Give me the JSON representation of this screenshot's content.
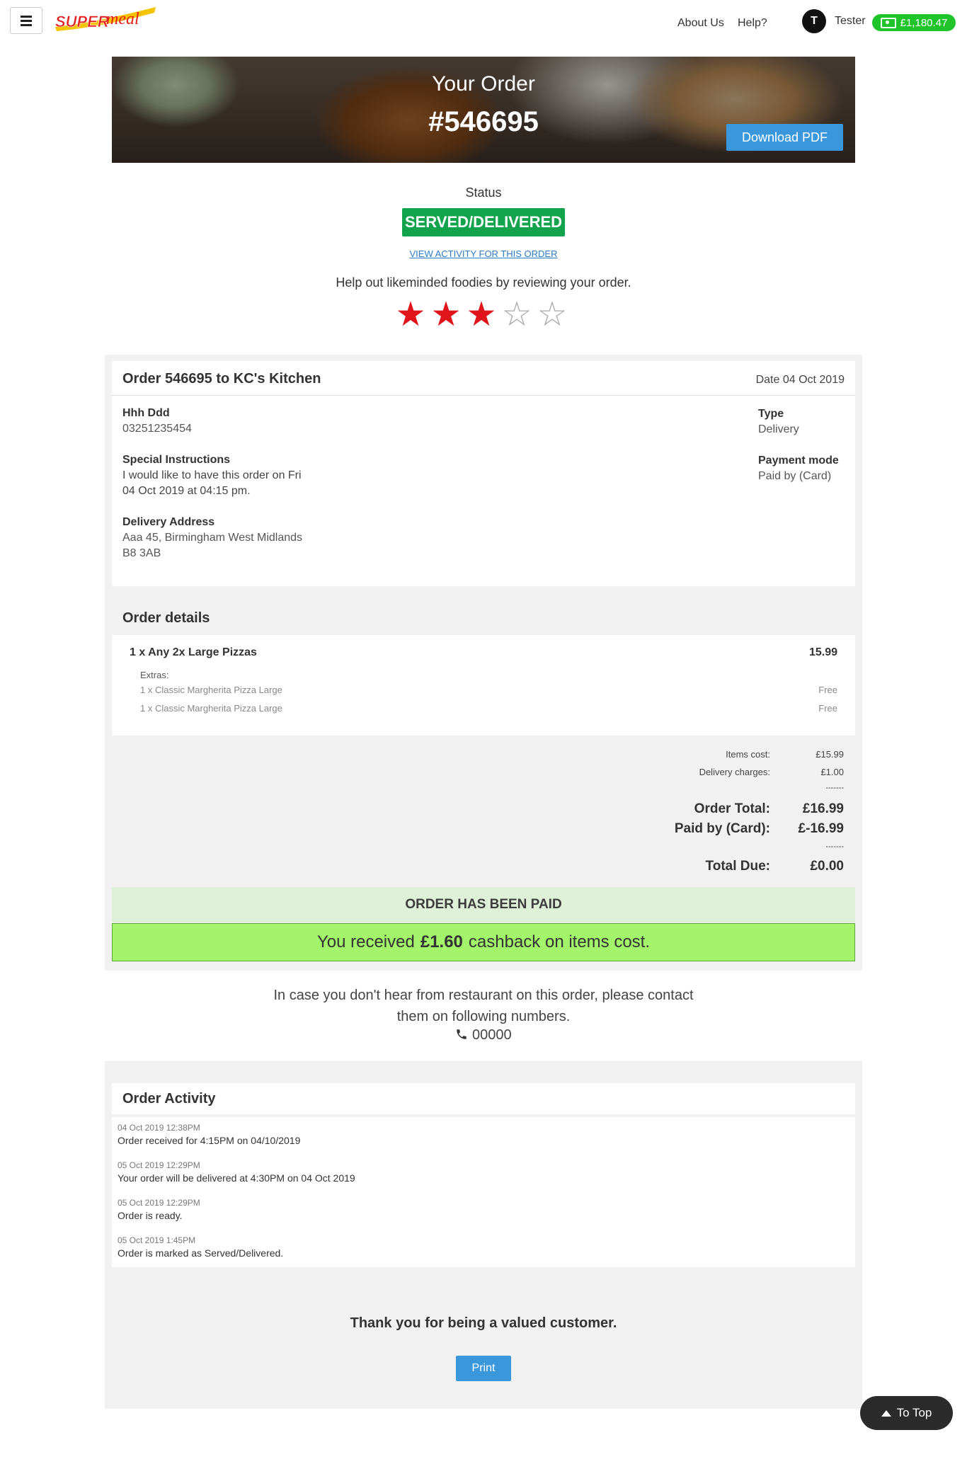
{
  "header": {
    "logo_text": "SUPERmeal",
    "nav": [
      "About Us",
      "Help?"
    ],
    "user_initial": "T",
    "user_name": "Tester",
    "wallet_balance": "£1,180.47"
  },
  "hero": {
    "title": "Your Order",
    "order_number": "#546695",
    "download_label": "Download PDF"
  },
  "status": {
    "label": "Status",
    "value": "SERVED/DELIVERED",
    "activity_link": "VIEW ACTIVITY FOR THIS ORDER",
    "review_prompt": "Help out likeminded foodies by reviewing your order.",
    "rating": 3,
    "rating_max": 5
  },
  "order": {
    "title": "Order 546695 to KC's Kitchen",
    "date": "Date 04 Oct 2019",
    "customer_name": "Hhh Ddd",
    "customer_phone": "03251235454",
    "special_label": "Special Instructions",
    "special_line1": "I would like to have this order on Fri",
    "special_line2": "04 Oct 2019 at 04:15 pm.",
    "address_label": "Delivery Address",
    "address_line1": "Aaa 45, Birmingham West Midlands",
    "address_line2": "B8 3AB",
    "type_label": "Type",
    "type_value": "Delivery",
    "payment_label": "Payment mode",
    "payment_value": "Paid by (Card)"
  },
  "details": {
    "title": "Order details",
    "item_name": "1 x Any 2x Large Pizzas",
    "item_price": "15.99",
    "extras_label": "Extras:",
    "extras": [
      {
        "name": "1 x Classic Margherita Pizza Large",
        "price": "Free"
      },
      {
        "name": "1 x Classic Margherita Pizza Large",
        "price": "Free"
      }
    ]
  },
  "summary": {
    "items_cost_label": "Items cost:",
    "items_cost": "£15.99",
    "delivery_label": "Delivery charges:",
    "delivery": "£1.00",
    "divider": "-------",
    "total_label": "Order Total:",
    "total": "£16.99",
    "paid_label": "Paid by (Card):",
    "paid": "£-16.99",
    "due_label": "Total Due:",
    "due": "£0.00",
    "paid_banner": "ORDER HAS BEEN PAID",
    "cashback_pre": "You received",
    "cashback_amount": "£1.60",
    "cashback_post": "cashback on items cost."
  },
  "contact": {
    "line1": "In case you don't hear from restaurant on this order, please contact",
    "line2": "them on following numbers.",
    "phone": "00000"
  },
  "activity": {
    "title": "Order Activity",
    "entries": [
      {
        "date": "04 Oct 2019 12:38PM",
        "text": "Order received for 4:15PM on 04/10/2019"
      },
      {
        "date": "05 Oct 2019 12:29PM",
        "text": "Your order will be delivered at 4:30PM on 04 Oct 2019"
      },
      {
        "date": "05 Oct 2019 12:29PM",
        "text": "Order is ready."
      },
      {
        "date": "05 Oct 2019 1:45PM",
        "text": "Order is marked as Served/Delivered."
      }
    ]
  },
  "footer": {
    "thanks": "Thank you for being a valued customer.",
    "print_label": "Print",
    "to_top_label": "To Top"
  },
  "colors": {
    "status_green": "#12a34c",
    "wallet_green": "#1fc42b",
    "button_blue": "#3a97dc",
    "star_red": "#e0141b",
    "cashback_green": "#a3f46b"
  }
}
